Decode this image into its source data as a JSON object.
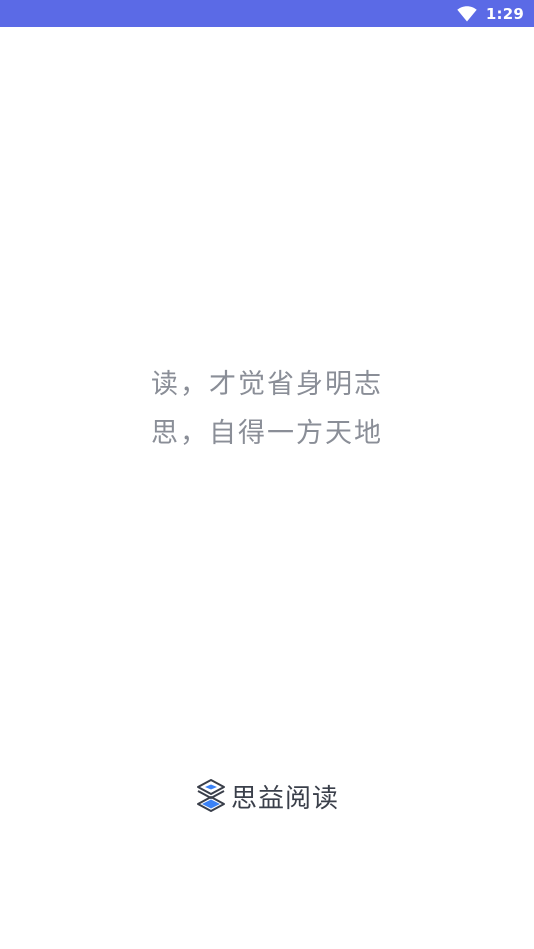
{
  "status_bar": {
    "time": "1:29",
    "wifi_icon": "wifi-icon",
    "background_color": "#5b6ae6"
  },
  "slogan": {
    "line1": "读，才觉省身明志",
    "line2": "思，自得一方天地",
    "color": "#8a8e97"
  },
  "brand": {
    "logo_icon": "layers-logo-icon",
    "name": "思益阅读",
    "accent_color": "#3b82f6"
  }
}
